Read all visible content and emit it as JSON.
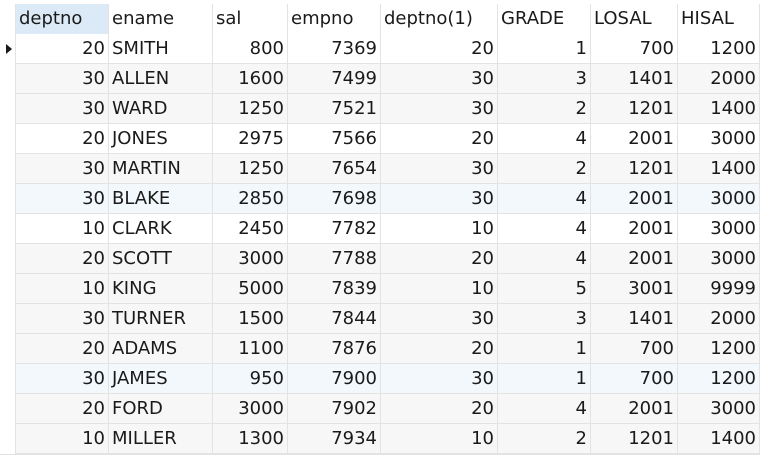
{
  "table": {
    "columns": [
      "deptno",
      "ename",
      "sal",
      "empno",
      "deptno(1)",
      "GRADE",
      "LOSAL",
      "HISAL"
    ],
    "sorted_column": "deptno",
    "current_row": 0,
    "row_indicator_icon": "row-pointer-icon",
    "rows": [
      [
        "20",
        "SMITH",
        "800",
        "7369",
        "20",
        "1",
        "700",
        "1200"
      ],
      [
        "30",
        "ALLEN",
        "1600",
        "7499",
        "30",
        "3",
        "1401",
        "2000"
      ],
      [
        "30",
        "WARD",
        "1250",
        "7521",
        "30",
        "2",
        "1201",
        "1400"
      ],
      [
        "20",
        "JONES",
        "2975",
        "7566",
        "20",
        "4",
        "2001",
        "3000"
      ],
      [
        "30",
        "MARTIN",
        "1250",
        "7654",
        "30",
        "2",
        "1201",
        "1400"
      ],
      [
        "30",
        "BLAKE",
        "2850",
        "7698",
        "30",
        "4",
        "2001",
        "3000"
      ],
      [
        "10",
        "CLARK",
        "2450",
        "7782",
        "10",
        "4",
        "2001",
        "3000"
      ],
      [
        "20",
        "SCOTT",
        "3000",
        "7788",
        "20",
        "4",
        "2001",
        "3000"
      ],
      [
        "10",
        "KING",
        "5000",
        "7839",
        "10",
        "5",
        "3001",
        "9999"
      ],
      [
        "30",
        "TURNER",
        "1500",
        "7844",
        "30",
        "3",
        "1401",
        "2000"
      ],
      [
        "20",
        "ADAMS",
        "1100",
        "7876",
        "20",
        "1",
        "700",
        "1200"
      ],
      [
        "30",
        "JAMES",
        "950",
        "7900",
        "30",
        "1",
        "700",
        "1200"
      ],
      [
        "20",
        "FORD",
        "3000",
        "7902",
        "20",
        "4",
        "2001",
        "3000"
      ],
      [
        "10",
        "MILLER",
        "1300",
        "7934",
        "10",
        "2",
        "1201",
        "1400"
      ]
    ],
    "colors": {
      "sorted_header_bg": "#dceaf7",
      "alt_row_bg": "#f7f7f7",
      "highlight_row_bg": "#f3f8fd",
      "grid_line": "#e3e3e3"
    }
  }
}
